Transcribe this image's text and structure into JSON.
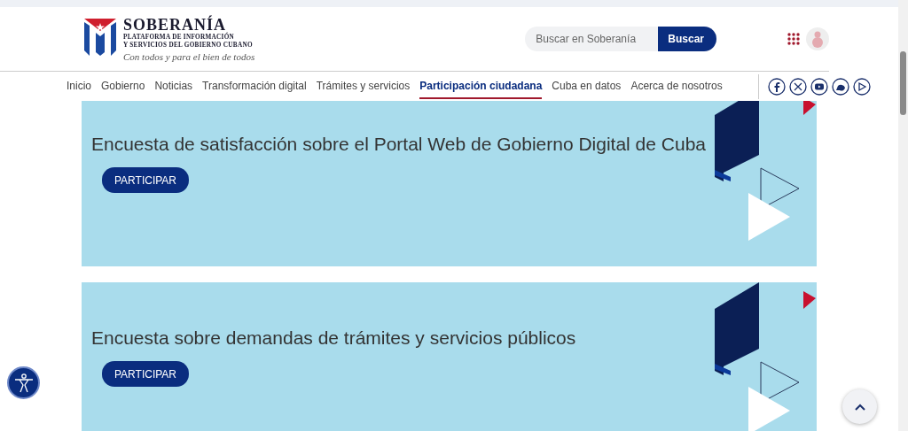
{
  "header": {
    "logo": {
      "title": "SOBERANÍA",
      "subtitle_lines": [
        "PLATAFORMA DE INFORMACIÓN",
        "Y SERVICIOS DEL GOBIERNO CUBANO"
      ],
      "tagline": "Con todos y para el bien de todos"
    },
    "search": {
      "placeholder": "Buscar en Soberanía",
      "button": "Buscar"
    }
  },
  "nav": [
    {
      "label": "Inicio",
      "selected": false
    },
    {
      "label": "Gobierno",
      "selected": false
    },
    {
      "label": "Noticias",
      "selected": false
    },
    {
      "label": "Transformación digital",
      "selected": false
    },
    {
      "label": "Trámites y servicios",
      "selected": false
    },
    {
      "label": "Participación ciudadana",
      "selected": true
    },
    {
      "label": "Cuba en datos",
      "selected": false
    },
    {
      "label": "Acerca de nosotros",
      "selected": false
    }
  ],
  "surveys": [
    {
      "title": "Encuesta de satisfacción sobre el Portal Web de Gobierno Digital de Cuba",
      "button": "PARTICIPAR"
    },
    {
      "title": "Encuesta sobre demandas de trámites y servicios públicos",
      "button": "PARTICIPAR"
    }
  ]
}
